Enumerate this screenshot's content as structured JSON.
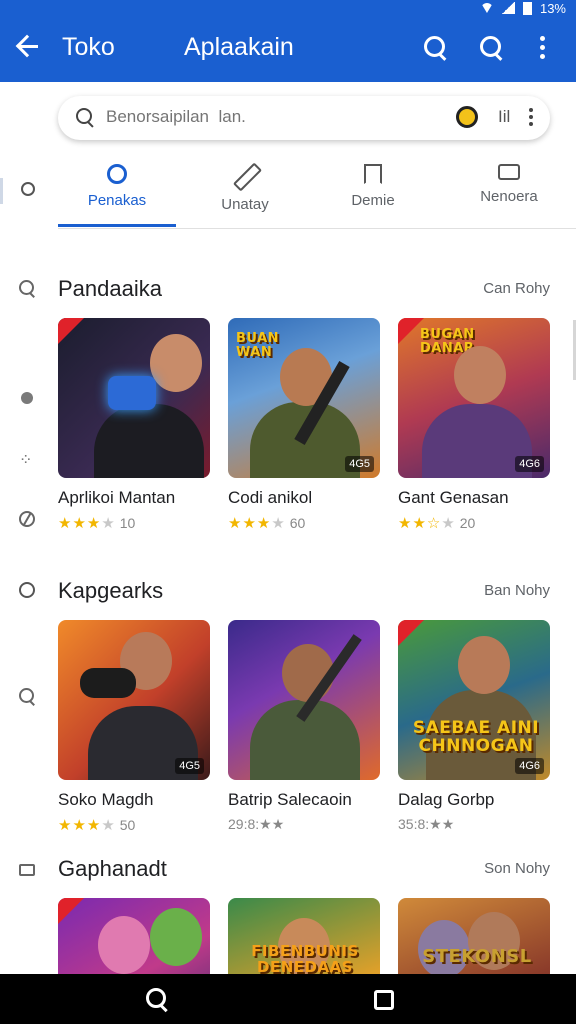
{
  "status_bar": {
    "time": "13%"
  },
  "app_bar": {
    "title": "Toko",
    "center_title": "Aplaakain"
  },
  "search": {
    "placeholder": "Benorsaipilan  lan.",
    "trailing_label": "Iil"
  },
  "tabs": [
    {
      "label": "Penakas",
      "icon": "store-icon",
      "active": true
    },
    {
      "label": "Unatay",
      "icon": "pencil-icon",
      "active": false
    },
    {
      "label": "Demie",
      "icon": "bookmark-icon",
      "active": false
    },
    {
      "label": "Nenoera",
      "icon": "chat-icon",
      "active": false
    }
  ],
  "sections": [
    {
      "title": "Pandaaika",
      "see_more": "Can Rohy",
      "items": [
        {
          "name": "Aprlikoi  Mantan",
          "stars": 3,
          "rating_text": "10",
          "size": ""
        },
        {
          "name": "Codi anikol",
          "stars": 3,
          "rating_text": "60",
          "size": "4G5"
        },
        {
          "name": "Gant Genasan",
          "stars": 2.5,
          "rating_text": "20",
          "size": "4G6"
        }
      ]
    },
    {
      "title": "Kapgearks",
      "see_more": "Ban Nohy",
      "items": [
        {
          "name": "Soko Magdh",
          "stars": 3,
          "rating_text": "50",
          "size": "4G5"
        },
        {
          "name": "Batrip Salecaoin",
          "stars": 0,
          "rating_text": "29:8:★★",
          "size": ""
        },
        {
          "name": "Dalag Gorbp",
          "stars": 0,
          "rating_text": "35:8:★★",
          "size": "4G6"
        }
      ]
    },
    {
      "title": "Gaphanadt",
      "see_more": "Son Nohy",
      "items": [
        {
          "name": "",
          "stars": 0,
          "rating_text": "",
          "size": ""
        },
        {
          "name": "",
          "stars": 0,
          "rating_text": "",
          "size": ""
        },
        {
          "name": "",
          "stars": 0,
          "rating_text": "",
          "size": ""
        }
      ]
    }
  ],
  "thumb_logos": {
    "s1i1": "BUGAN DANAR",
    "s1i2": "BUAN WAN",
    "s2i2": "",
    "s2i3": "SAEBAE AINI CHNNOGAN",
    "s3i1": "",
    "s3i2": "FIBENBUNIS DENEDAAS",
    "s3i3": "STEKONSL"
  },
  "colors": {
    "primary": "#1a5fd0",
    "star": "#f2b600",
    "nav_bar": "#000000"
  }
}
